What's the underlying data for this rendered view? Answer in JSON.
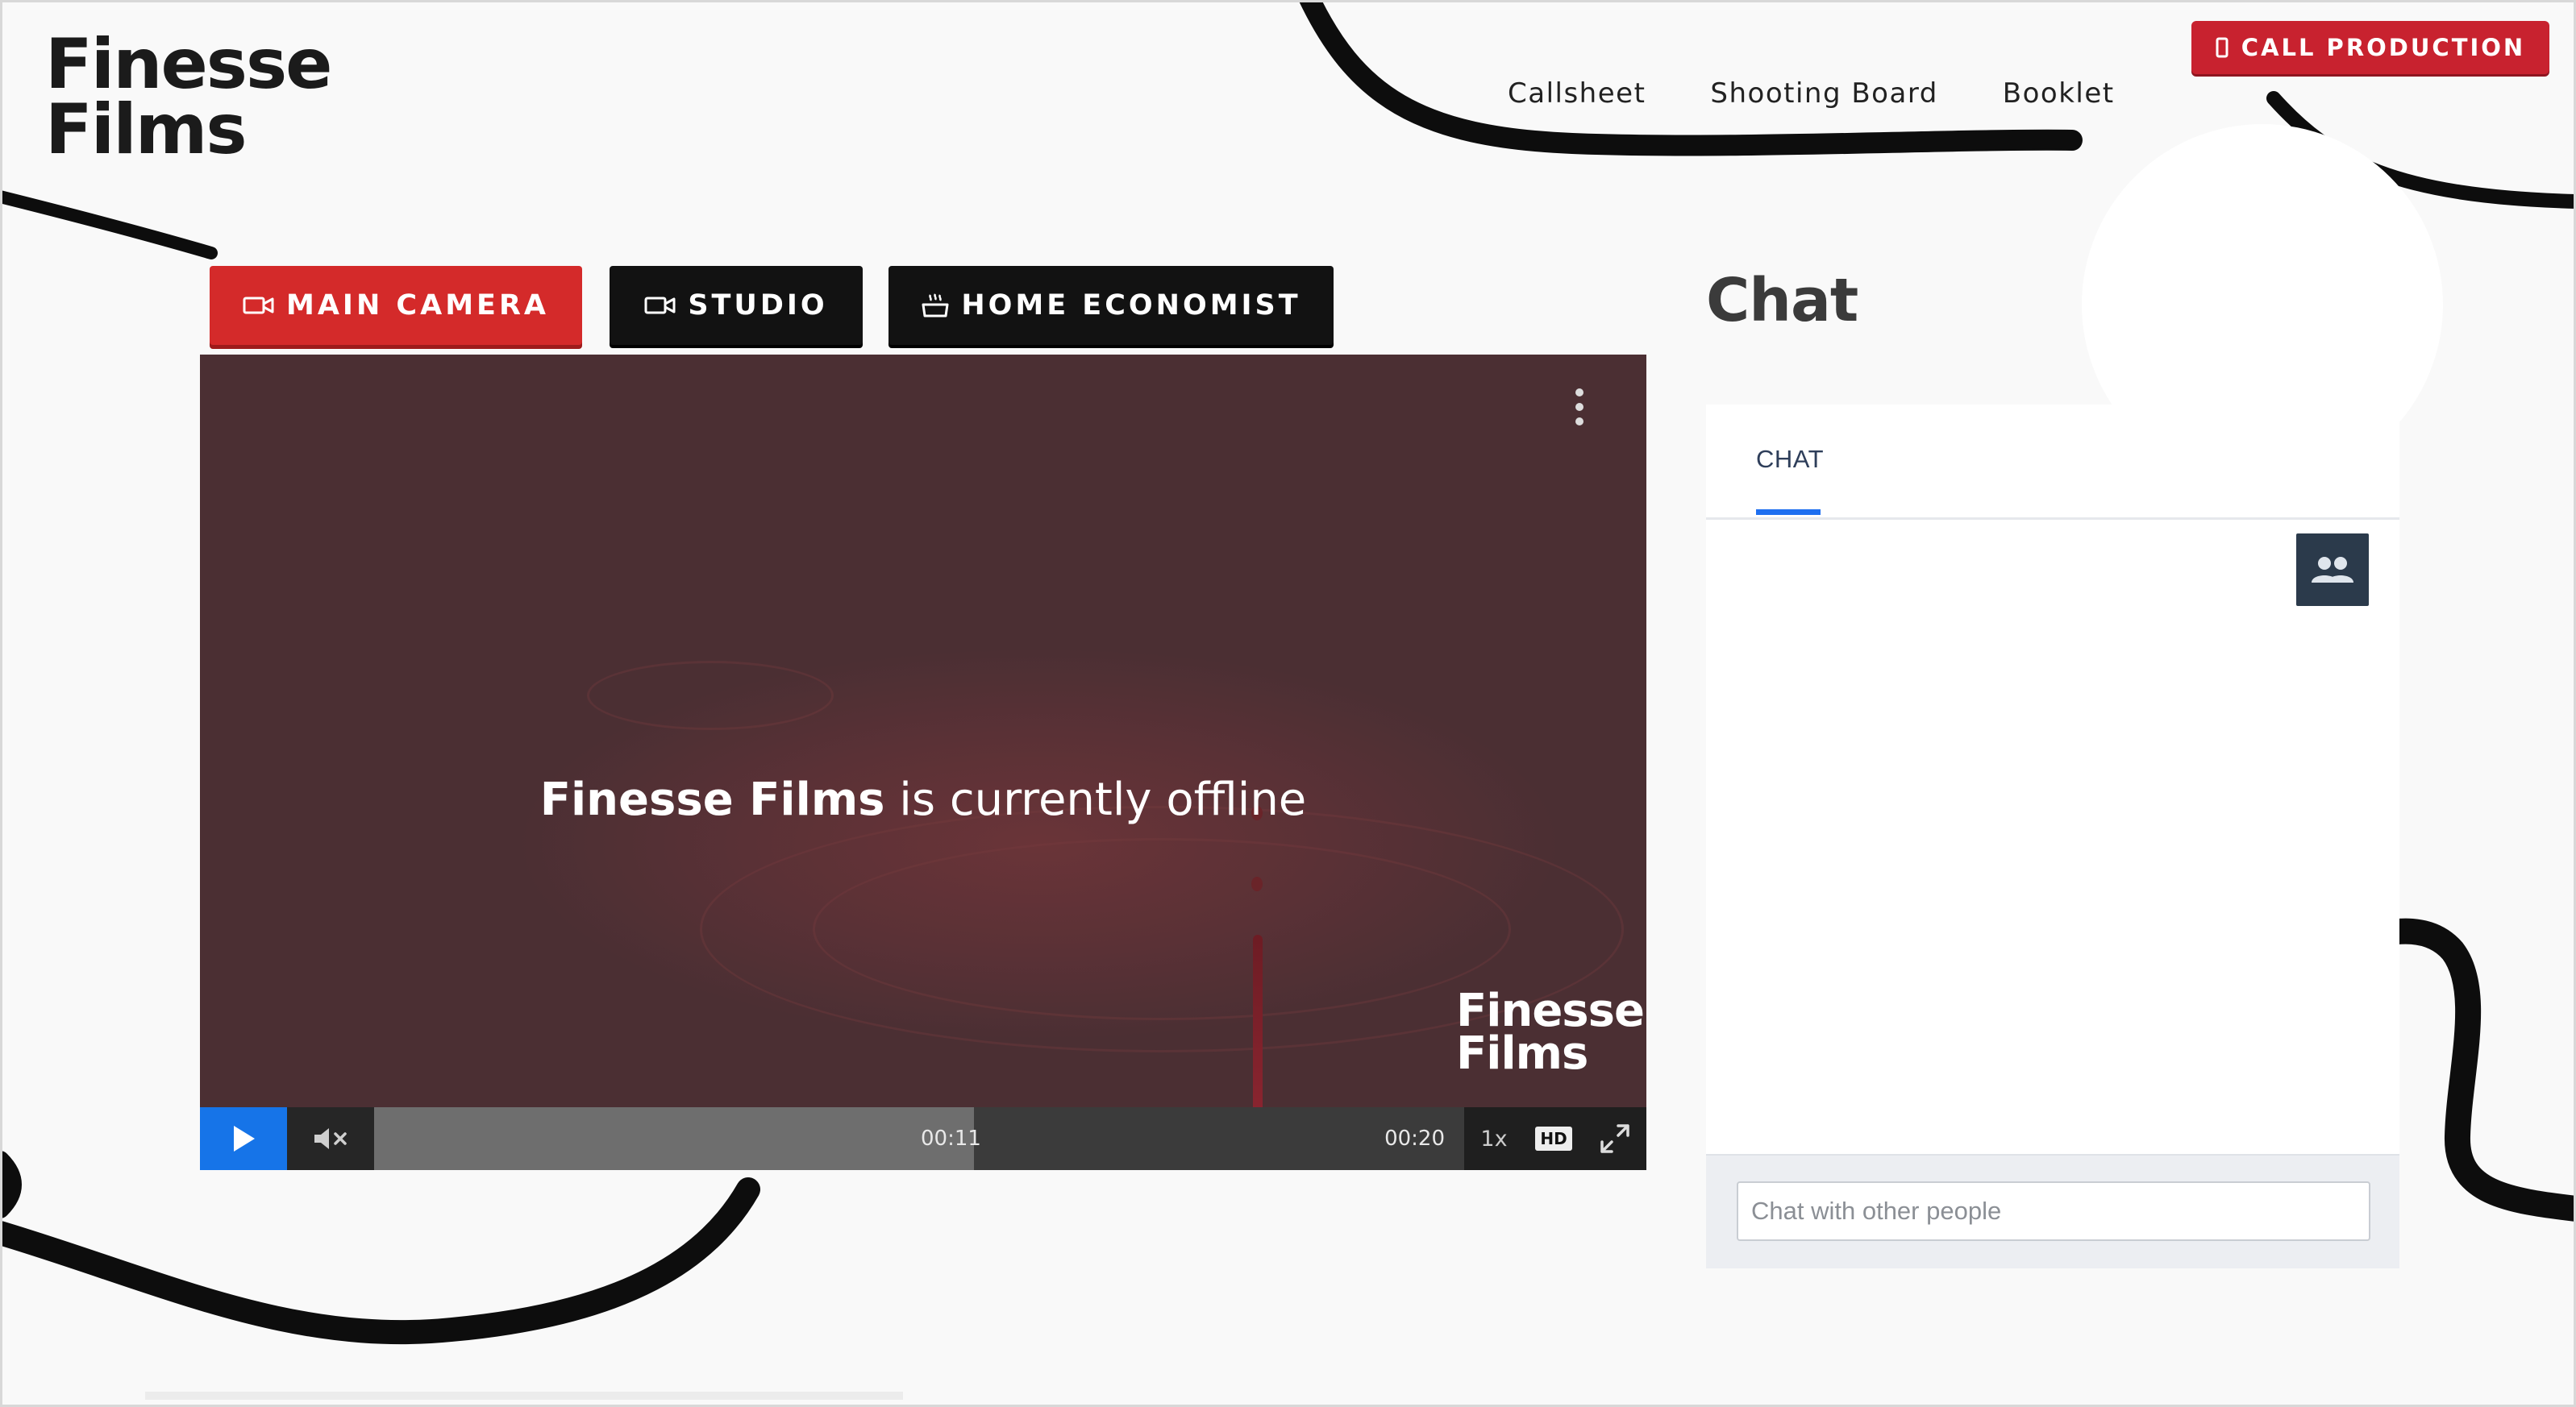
{
  "brand": {
    "line1": "Finesse",
    "line2": "Films"
  },
  "nav": {
    "items": [
      "Callsheet",
      "Shooting Board",
      "Booklet"
    ]
  },
  "call_button": {
    "label": "CALL PRODUCTION",
    "icon": "phone-icon",
    "color": "#c8222f"
  },
  "camera_tabs": [
    {
      "label": "MAIN CAMERA",
      "icon": "video-camera-icon",
      "active": true,
      "color": "#d42a2a"
    },
    {
      "label": "STUDIO",
      "icon": "video-camera-icon",
      "active": false,
      "color": "#121212"
    },
    {
      "label": "HOME ECONOMIST",
      "icon": "cooking-pot-icon",
      "active": false,
      "color": "#121212"
    }
  ],
  "player": {
    "offline_brand": "Finesse Films",
    "offline_text": " is currently offline",
    "watermark": {
      "line1": "Finesse",
      "line2": "Films"
    },
    "current_time": "00:11",
    "duration": "00:20",
    "buffered_fraction": 0.55,
    "speed": "1x",
    "quality_badge": "HD",
    "accent": "#1674e8"
  },
  "chat": {
    "title": "Chat",
    "tab": "CHAT",
    "input_placeholder": "Chat with other people",
    "accent": "#1e6ff0"
  }
}
